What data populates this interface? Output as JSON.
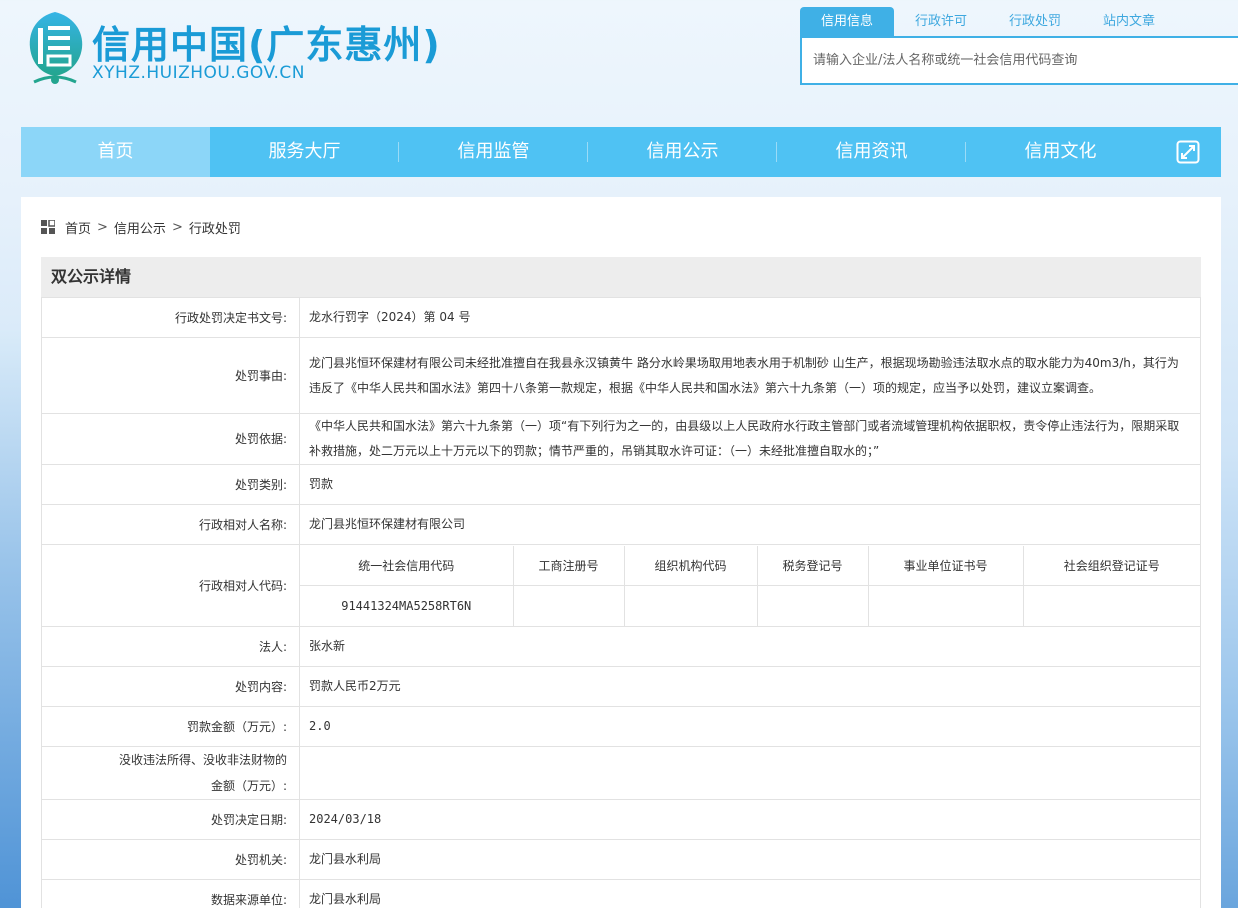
{
  "header": {
    "site_title": "信用中国(广东惠州)",
    "site_domain": "XYHZ.HUIZHOU.GOV.CN",
    "search_tabs": [
      {
        "label": "信用信息",
        "active": true
      },
      {
        "label": "行政许可",
        "active": false
      },
      {
        "label": "行政处罚",
        "active": false
      },
      {
        "label": "站内文章",
        "active": false
      }
    ],
    "search_placeholder": "请输入企业/法人名称或统一社会信用代码查询"
  },
  "nav": {
    "items": [
      {
        "label": "首页",
        "active": true
      },
      {
        "label": "服务大厅",
        "active": false
      },
      {
        "label": "信用监管",
        "active": false
      },
      {
        "label": "信用公示",
        "active": false
      },
      {
        "label": "信用资讯",
        "active": false
      },
      {
        "label": "信用文化",
        "active": false
      }
    ],
    "expand_icon": "expand-icon"
  },
  "breadcrumb": {
    "icon": "grid-icon",
    "items": [
      "首页",
      "信用公示",
      "行政处罚"
    ],
    "separator": ">"
  },
  "panel": {
    "title": "双公示详情",
    "rows": {
      "doc_no": {
        "label": "行政处罚决定书文号:",
        "value": "龙水行罚字（2024）第 04 号"
      },
      "reason": {
        "label": "处罚事由:",
        "value": "龙门县兆恒环保建材有限公司未经批准擅自在我县永汉镇黄牛 路分水岭果场取用地表水用于机制砂 山生产，根据现场勘验违法取水点的取水能力为40m3/h，其行为违反了《中华人民共和国水法》第四十八条第一款规定，根据《中华人民共和国水法》第六十九条第（一）项的规定，应当予以处罚，建议立案调查。"
      },
      "basis": {
        "label": "处罚依据:",
        "value": "《中华人民共和国水法》第六十九条第（一）项“有下列行为之一的，由县级以上人民政府水行政主管部门或者流域管理机构依据职权，责令停止违法行为，限期采取补救措施，处二万元以上十万元以下的罚款；情节严重的，吊销其取水许可证：（一）未经批准擅自取水的；”"
      },
      "category": {
        "label": "处罚类别:",
        "value": "罚款"
      },
      "party_name": {
        "label": "行政相对人名称:",
        "value": "龙门县兆恒环保建材有限公司"
      },
      "party_code": {
        "label": "行政相对人代码:",
        "headers": [
          "统一社会信用代码",
          "工商注册号",
          "组织机构代码",
          "税务登记号",
          "事业单位证书号",
          "社会组织登记证号"
        ],
        "values": [
          "91441324MA5258RT6N",
          "",
          "",
          "",
          "",
          ""
        ]
      },
      "legal_person": {
        "label": "法人:",
        "value": "张水新"
      },
      "content": {
        "label": "处罚内容:",
        "value": "罚款人民币2万元"
      },
      "fine": {
        "label": "罚款金额（万元）:",
        "value": "2.0"
      },
      "confiscation": {
        "label_line1": "没收违法所得、没收非法财物的",
        "label_line2": "金额（万元）:",
        "value": ""
      },
      "decision_date": {
        "label": "处罚决定日期:",
        "value": "2024/03/18"
      },
      "authority": {
        "label": "处罚机关:",
        "value": "龙门县水利局"
      },
      "source": {
        "label": "数据来源单位:",
        "value": "龙门县水利局"
      }
    }
  },
  "colors": {
    "brand": "#1a9bd6",
    "nav_bg": "#4fc2f3",
    "nav_active": "#8cd6f8",
    "tab_active": "#3fb0e6"
  }
}
